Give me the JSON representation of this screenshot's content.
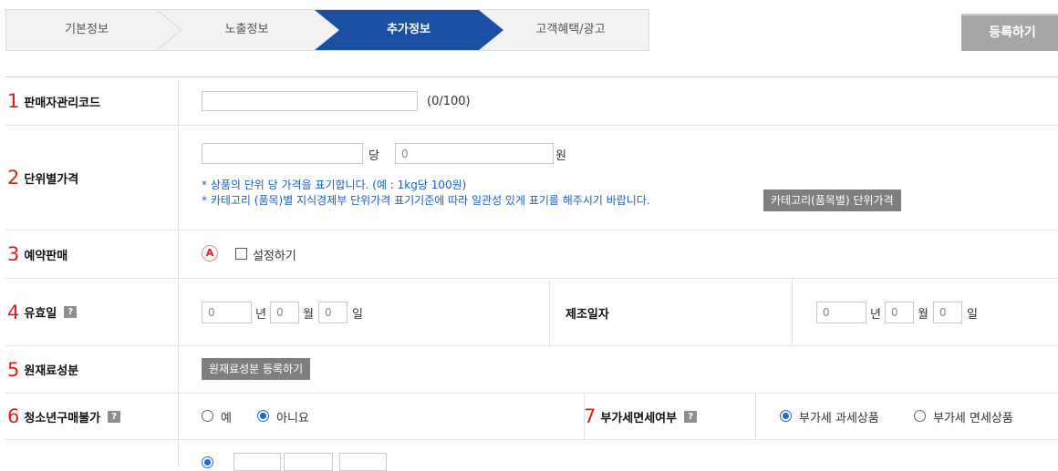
{
  "steps": [
    {
      "label": "기본정보",
      "active": false
    },
    {
      "label": "노출정보",
      "active": false
    },
    {
      "label": "추가정보",
      "active": true
    },
    {
      "label": "고객혜택/광고",
      "active": false
    }
  ],
  "register_button": "등록하기",
  "rows": {
    "seller_code": {
      "num": "1",
      "label": "판매자관리코드",
      "value": "",
      "counter": "(0/100)"
    },
    "unit_price": {
      "num": "2",
      "label": "단위별가격",
      "unit_value": "",
      "per": "당",
      "price_value": "0",
      "won": "원",
      "note1": "* 상품의 단위 당 가격을 표기합니다. (예 : 1kg당 100원)",
      "note2": "* 카테고리 (품목)별 지식경제부 단위가격 표기기준에 따라 일관성 있게 표기를 해주시기 바랍니다.",
      "category_button": "카테고리(품목별) 단위가격"
    },
    "preorder": {
      "num": "3",
      "label": "예약판매",
      "badge": "A",
      "checkbox_label": "설정하기",
      "checked": false
    },
    "expiry": {
      "num": "4",
      "label": "유효일",
      "help": "?",
      "year": "0",
      "year_unit": "년",
      "month": "0",
      "month_unit": "월",
      "day": "0",
      "day_unit": "일",
      "mfg_label": "제조일자",
      "mfg_year": "0",
      "mfg_month": "0",
      "mfg_day": "0"
    },
    "ingredients": {
      "num": "5",
      "label": "원재료성분",
      "button": "원재료성분 등록하기"
    },
    "youth": {
      "num": "6",
      "label": "청소년구매불가",
      "help": "?",
      "options": [
        "예",
        "아니요"
      ],
      "selected": "아니요"
    },
    "vat": {
      "num": "7",
      "label": "부가세면세여부",
      "help": "?",
      "options": [
        "부가세 과세상품",
        "부가세 면세상품"
      ],
      "selected": "부가세 과세상품"
    }
  },
  "colors": {
    "active_step": "#1b4fa3",
    "step_bg": "#f2f2f2",
    "register_btn": "#a6a6a6",
    "number_red": "#e31b1b",
    "note_blue": "#1a5ec7",
    "radio_blue": "#1e6ad6"
  }
}
